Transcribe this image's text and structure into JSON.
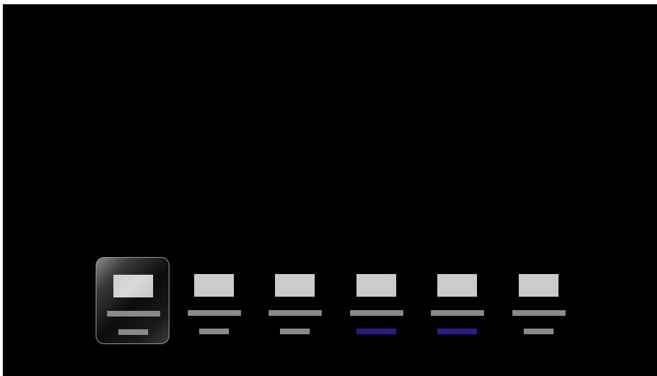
{
  "tiles": [
    {
      "id": "tile-1",
      "selected": true,
      "subtitle_color": "#8a8a8a",
      "subtitle_wide": false
    },
    {
      "id": "tile-2",
      "selected": false,
      "subtitle_color": "#8a8a8a",
      "subtitle_wide": false
    },
    {
      "id": "tile-3",
      "selected": false,
      "subtitle_color": "#8a8a8a",
      "subtitle_wide": false
    },
    {
      "id": "tile-4",
      "selected": false,
      "subtitle_color": "#2e1a87",
      "subtitle_wide": true
    },
    {
      "id": "tile-5",
      "selected": false,
      "subtitle_color": "#2e1a87",
      "subtitle_wide": true
    },
    {
      "id": "tile-6",
      "selected": false,
      "subtitle_color": "#8a8a8a",
      "subtitle_wide": false
    }
  ],
  "colors": {
    "background": "#000000",
    "placeholder_gray": "#8a8a8a",
    "thumbnail": "#cbcbcb",
    "accent_purple": "#2e1a87",
    "selected_border": "#9a9a9a"
  }
}
